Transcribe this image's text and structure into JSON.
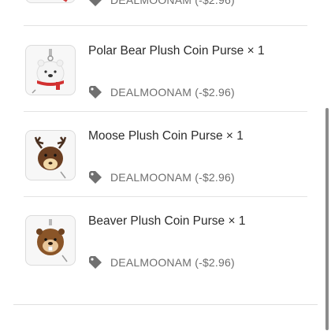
{
  "order_items": [
    {
      "name": "",
      "discount_label": "DEALMOONAM (-$2.96)",
      "thumb_icon": "plush-coin-purse-icon"
    },
    {
      "name": "Polar Bear Plush Coin Purse × 1",
      "discount_label": "DEALMOONAM (-$2.96)",
      "thumb_icon": "polar-bear-plush-icon"
    },
    {
      "name": "Moose Plush Coin Purse × 1",
      "discount_label": "DEALMOONAM (-$2.96)",
      "thumb_icon": "moose-plush-icon"
    },
    {
      "name": "Beaver Plush Coin Purse × 1",
      "discount_label": "DEALMOONAM (-$2.96)",
      "thumb_icon": "beaver-plush-icon"
    }
  ],
  "colors": {
    "text": "#2b2b2b",
    "muted": "#6e6e6e",
    "tag_icon": "#707070",
    "divider": "#e3e3e3"
  }
}
